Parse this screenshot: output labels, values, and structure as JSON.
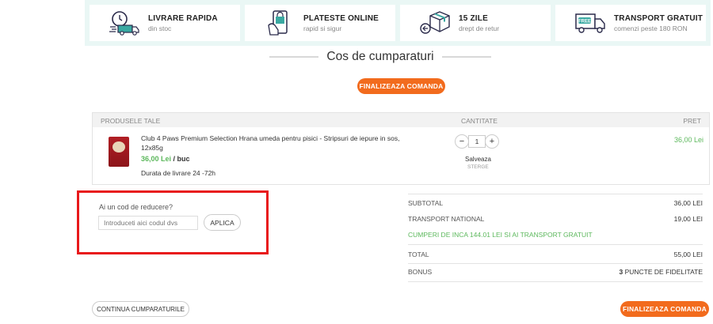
{
  "benefits": [
    {
      "icon": "fast-delivery-icon",
      "title": "LIVRARE RAPIDA",
      "subtitle": "din stoc"
    },
    {
      "icon": "online-payment-icon",
      "title": "PLATESTE ONLINE",
      "subtitle": "rapid si sigur"
    },
    {
      "icon": "return-box-icon",
      "title": "15 ZILE",
      "subtitle": "drept de retur"
    },
    {
      "icon": "free-shipping-truck-icon",
      "title": "TRANSPORT GRATUIT",
      "subtitle": "comenzi peste 180 RON"
    }
  ],
  "page_title": "Cos de cumparaturi",
  "checkout_label": "FINALIZEAZA COMANDA",
  "cart": {
    "headers": {
      "products": "PRODUSELE TALE",
      "quantity": "CANTITATE",
      "price": "PRET"
    },
    "item": {
      "name": "Club 4 Paws Premium Selection Hrana umeda pentru pisici - Stripsuri de iepure in sos, 12x85g",
      "unit_price": "36,00 Lei",
      "unit_suffix": " / buc",
      "delivery": "Durata de livrare 24 -72h",
      "qty_minus": "−",
      "qty": "1",
      "qty_plus": "+",
      "save": "Salveaza",
      "remove": "STERGE",
      "price": "36,00 Lei"
    }
  },
  "discount": {
    "label": "Ai un cod de reducere?",
    "placeholder": "Introduceti aici codul dvs",
    "apply": "APLICA"
  },
  "totals": {
    "subtotal_label": "SUBTOTAL",
    "subtotal_value": "36,00 LEI",
    "transport_label": "TRANSPORT NATIONAL",
    "transport_value": "19,00 LEI",
    "promo": "CUMPERI DE INCA 144.01 LEI SI AI TRANSPORT GRATUIT",
    "total_label": "TOTAL",
    "total_value": "55,00 LEI",
    "bonus_label": "BONUS",
    "bonus_points": "3",
    "bonus_text": " PUNCTE DE FIDELITATE"
  },
  "continue_label": "CONTINUA CUMPARATURILE",
  "colors": {
    "accent": "#f26b1d",
    "green": "#5cb85c",
    "highlight": "#e8191b",
    "teal_bg": "#eaf7f5"
  }
}
